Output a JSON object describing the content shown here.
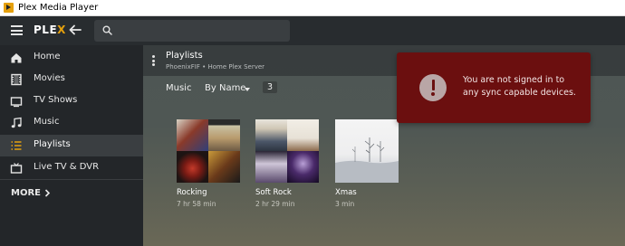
{
  "window": {
    "title": "Plex Media Player"
  },
  "header": {
    "logo_main": "PLE",
    "logo_accent": "X",
    "search": {
      "value": "",
      "placeholder": ""
    }
  },
  "sidebar": {
    "items": [
      {
        "label": "Home",
        "icon": "home-icon"
      },
      {
        "label": "Movies",
        "icon": "film-icon"
      },
      {
        "label": "TV Shows",
        "icon": "tv-icon"
      },
      {
        "label": "Music",
        "icon": "music-note-icon"
      },
      {
        "label": "Playlists",
        "icon": "list-icon",
        "active": true
      },
      {
        "label": "Live TV & DVR",
        "icon": "live-tv-icon"
      }
    ],
    "more_label": "MORE"
  },
  "main": {
    "title": "Playlists",
    "subtitle": "PhoenixFIF • Home Plex Server",
    "filter": {
      "type": "Music",
      "sort": "By Name",
      "count": "3"
    },
    "playlists": [
      {
        "name": "Rocking",
        "duration": "7 hr 58 min"
      },
      {
        "name": "Soft Rock",
        "duration": "2 hr 29 min"
      },
      {
        "name": "Xmas",
        "duration": "3 min"
      }
    ]
  },
  "toast": {
    "message": "You are not signed in to any sync capable devices.",
    "icon": "exclamation-icon"
  },
  "colors": {
    "accent": "#e5a00d",
    "toast_bg": "#6b0f0f",
    "sidebar_bg": "#232629",
    "active_item_bg": "#3a3e41"
  }
}
